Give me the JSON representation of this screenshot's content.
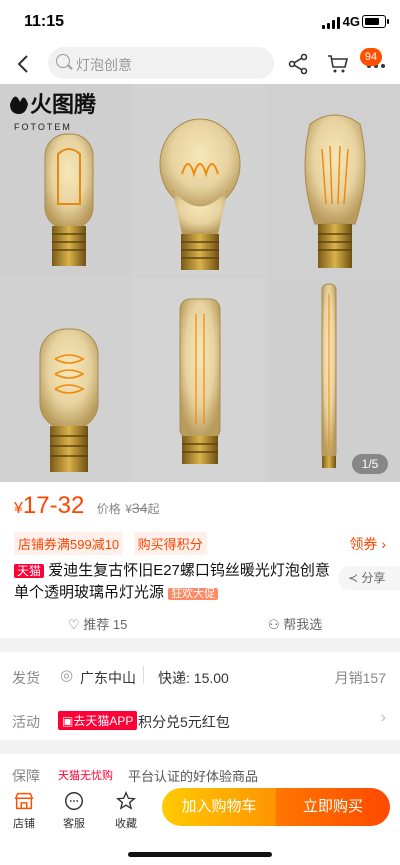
{
  "status": {
    "time": "11:15",
    "network": "4G"
  },
  "nav": {
    "search_placeholder": "灯泡创意",
    "cart_badge": "94"
  },
  "gallery": {
    "brand_cn": "火图腾",
    "brand_en": "FOTOTEM",
    "pager": "1/5"
  },
  "price": {
    "currency": "¥",
    "range": "17-32",
    "original_label": "价格",
    "original_currency": "¥",
    "original_value": "34",
    "original_suffix": "起",
    "coupon": "店铺券满599减10",
    "points": "购买得积分",
    "coupon_action": "领券"
  },
  "product": {
    "tmall_tag": "天猫",
    "title": "爱迪生复古怀旧E27螺口钨丝暖光灯泡创意单个透明玻璃吊灯光源",
    "promo_tag": "狂欢大促",
    "share": "分享",
    "recommend": "推荐 15",
    "help_choose": "帮我选"
  },
  "shipping": {
    "label": "发货",
    "location": "广东中山",
    "express": "快递: 15.00",
    "monthly_sales": "月销157"
  },
  "activity": {
    "label": "活动",
    "app_tag": "去天猫APP",
    "text": "积分兑5元红包"
  },
  "guarantee": {
    "label": "保障",
    "tag": "天猫无忧购",
    "text": "平台认证的好体验商品"
  },
  "bottom": {
    "store": "店铺",
    "service": "客服",
    "favorite": "收藏",
    "add_to_cart": "加入购物车",
    "buy_now": "立即购买"
  },
  "colors": {
    "accent": "#ff4400",
    "tmall_red": "#ff0036",
    "cart_yellow": "#ffb000",
    "buy_orange": "#ff5000"
  }
}
